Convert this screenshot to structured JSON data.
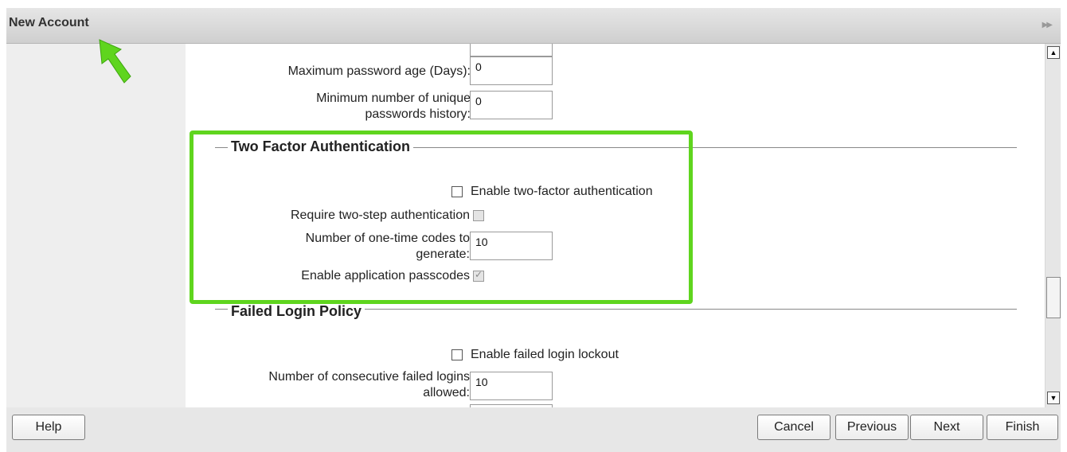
{
  "window": {
    "title": "New Account",
    "collapse_icon": "double-chevron-right-icon"
  },
  "password_policy": {
    "max_age_label": "Maximum password age (Days):",
    "max_age_value": "0",
    "unique_history_label_line1": "Minimum number of unique",
    "unique_history_label_line2": "passwords history:",
    "unique_history_value": "0"
  },
  "two_factor": {
    "legend": "Two Factor Authentication",
    "enable_label": "Enable two-factor authentication",
    "enable_checked": false,
    "require_two_step_label": "Require two-step authentication",
    "require_two_step_checked": false,
    "one_time_codes_label_line1": "Number of one-time codes to",
    "one_time_codes_label_line2": "generate:",
    "one_time_codes_value": "10",
    "app_passcodes_label": "Enable application passcodes",
    "app_passcodes_checked": true
  },
  "failed_login": {
    "legend": "Failed Login Policy",
    "enable_lockout_label": "Enable failed login lockout",
    "enable_lockout_checked": false,
    "consecutive_label_line1": "Number of consecutive failed logins",
    "consecutive_label_line2": "allowed:",
    "consecutive_value": "10"
  },
  "footer": {
    "help": "Help",
    "cancel": "Cancel",
    "previous": "Previous",
    "next": "Next",
    "finish": "Finish"
  },
  "colors": {
    "highlight": "#5fd51e",
    "pointer_arrow": "#5fd51e"
  }
}
